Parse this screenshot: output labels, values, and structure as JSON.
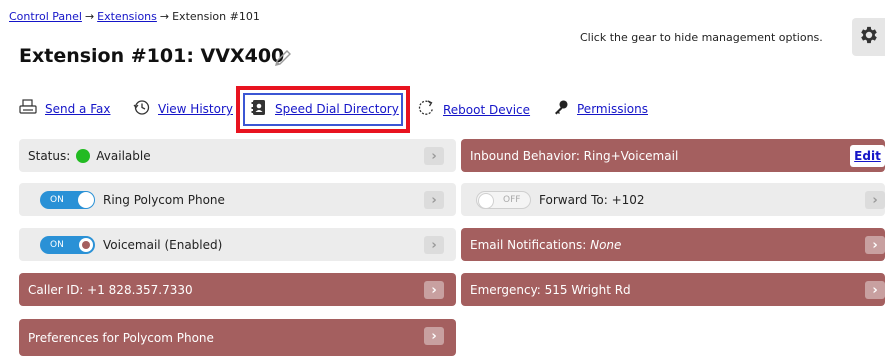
{
  "breadcrumb": {
    "items": [
      "Control Panel",
      "Extensions",
      "Extension #101"
    ],
    "separator": "→"
  },
  "page": {
    "title": "Extension #101: VVX400",
    "hint": "Click the gear to hide management options."
  },
  "actions": [
    {
      "label": "Send a Fax",
      "icon": "fax-icon"
    },
    {
      "label": "View History",
      "icon": "history-icon"
    },
    {
      "label": "Speed Dial Directory",
      "icon": "address-book-icon"
    },
    {
      "label": "Reboot Device",
      "icon": "reboot-icon"
    },
    {
      "label": "Permissions",
      "icon": "key-icon"
    }
  ],
  "left_rows": {
    "status": {
      "label": "Status:",
      "value": "Available"
    },
    "ring": {
      "toggle": "ON",
      "label": "Ring Polycom Phone"
    },
    "voicemail": {
      "toggle": "ON",
      "label": "Voicemail (Enabled)"
    },
    "caller_id": {
      "label": "Caller ID: +1 828.357.7330"
    },
    "preferences": {
      "label": "Preferences for Polycom Phone"
    }
  },
  "right_rows": {
    "inbound": {
      "label": "Inbound Behavior: Ring+Voicemail",
      "edit": "Edit"
    },
    "forward": {
      "toggle": "OFF",
      "label": "Forward To: +102"
    },
    "email": {
      "label": "Email Notifications:",
      "value": "None"
    },
    "emergency": {
      "label": "Emergency: 515 Wright Rd"
    }
  },
  "chevron": "›",
  "colors": {
    "link": "#1515c8",
    "maroon": "#a45f5f",
    "grey_row": "#ececec",
    "toggle_on": "#2a91d6",
    "status_green": "#22bb22",
    "highlight": "#e8131f"
  }
}
